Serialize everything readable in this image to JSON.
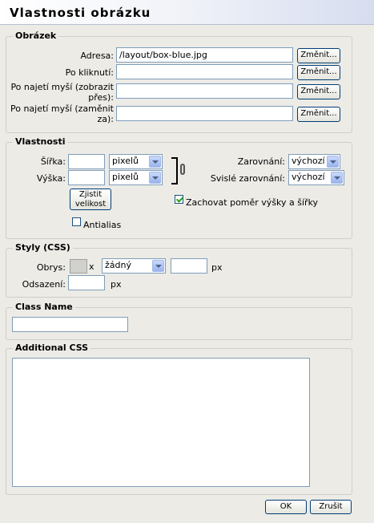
{
  "dialog": {
    "title": "Vlastnosti obrázku"
  },
  "image_section": {
    "legend": "Obrázek",
    "address_label": "Adresa:",
    "address_value": "/layout/box-blue.jpg",
    "onclick_label": "Po kliknutí:",
    "hover_show_label_1": "Po najetí myší (zobrazit",
    "hover_show_label_2": "přes):",
    "hover_replace_label_1": "Po najetí myší (zaměnit",
    "hover_replace_label_2": "za):",
    "change_button": "Změnit..."
  },
  "properties": {
    "legend": "Vlastnosti",
    "width_label": "Šířka:",
    "height_label": "Výška:",
    "unit_value": "pixelů",
    "detect_size_1": "Zjistit",
    "detect_size_2": "velikost",
    "antialias_label": "Antialias",
    "align_label": "Zarovnání:",
    "align_value": "výchozí",
    "valign_label": "Svislé zarovnání:",
    "valign_value": "výchozí",
    "keep_ratio_label": "Zachovat poměr výšky a šířky",
    "keep_ratio_checked": true,
    "antialias_checked": false
  },
  "styles": {
    "legend": "Styly (CSS)",
    "border_label": "Obrys:",
    "border_clear": "x",
    "border_style_value": "žádný",
    "border_unit": "px",
    "padding_label": "Odsazení:",
    "padding_unit": "px"
  },
  "classname": {
    "legend": "Class Name"
  },
  "additional_css": {
    "legend": "Additional CSS"
  },
  "footer": {
    "ok": "OK",
    "cancel": "Zrušit"
  }
}
